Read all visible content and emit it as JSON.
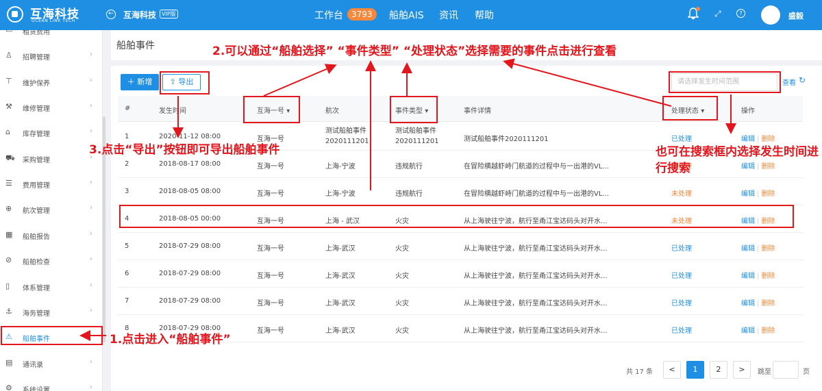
{
  "topbar": {
    "logo_cn": "互海科技",
    "logo_en": "OCEAN LINK TECH",
    "company": "互海科技",
    "vip_tag": "VIP版",
    "menu": [
      {
        "label": "工作台"
      },
      {
        "label": "船舶AIS"
      },
      {
        "label": "资讯"
      },
      {
        "label": "帮助"
      }
    ],
    "workbench_count": "3793",
    "username": "盛毅",
    "accent_color": "#1f8fe4",
    "badge_color": "#f5883a"
  },
  "sidebar": {
    "items": [
      {
        "label": "租赁费用",
        "icon": "lease-icon"
      },
      {
        "label": "招聘管理",
        "icon": "user-icon"
      },
      {
        "label": "维护保养",
        "icon": "tool-icon"
      },
      {
        "label": "维修管理",
        "icon": "wrench-icon"
      },
      {
        "label": "库存管理",
        "icon": "warehouse-icon"
      },
      {
        "label": "采购管理",
        "icon": "cart-icon"
      },
      {
        "label": "费用管理",
        "icon": "coins-icon"
      },
      {
        "label": "航次管理",
        "icon": "globe-icon"
      },
      {
        "label": "船舶报告",
        "icon": "report-icon"
      },
      {
        "label": "船舶检查",
        "icon": "check-icon"
      },
      {
        "label": "体系管理",
        "icon": "book-icon"
      },
      {
        "label": "海务管理",
        "icon": "anchor-icon"
      },
      {
        "label": "船舶事件",
        "icon": "warning-icon",
        "active": true
      },
      {
        "label": "通讯录",
        "icon": "contacts-icon"
      },
      {
        "label": "系统设置",
        "icon": "settings-icon"
      }
    ]
  },
  "main": {
    "page_title": "船舶事件",
    "add_label": "新增",
    "export_label": "导出",
    "search_placeholder": "请选择发生时间范围",
    "query_label": "查看",
    "columns": [
      "#",
      "发生时间",
      "互海一号",
      "航次",
      "事件类型",
      "事件详情",
      "处理状态",
      "操作"
    ],
    "edit_label": "编辑",
    "delete_label": "删除",
    "rows": [
      {
        "no": "1",
        "time": "2020-11-12 08:00",
        "ship": "互海一号",
        "voyage": "测试船舶事件2020111201",
        "type": "测试船舶事件2020111201",
        "detail": "测试船舶事件2020111201",
        "status": "已处理",
        "status_kind": "done"
      },
      {
        "no": "2",
        "time": "2018-08-17 08:00",
        "ship": "互海一号",
        "voyage": "上海-宁波",
        "type": "违规航行",
        "detail": "在冒险横越虾峙门航道的过程中与一出港的VL...",
        "status": "未处理",
        "status_kind": "pending"
      },
      {
        "no": "3",
        "time": "2018-08-05 08:00",
        "ship": "互海一号",
        "voyage": "上海-宁波",
        "type": "违规航行",
        "detail": "在冒险横越虾峙门航道的过程中与一出港的VL...",
        "status": "未处理",
        "status_kind": "pending"
      },
      {
        "no": "4",
        "time": "2018-08-05 00:00",
        "ship": "互海一号",
        "voyage": "上海 - 武汉",
        "type": "火灾",
        "detail": "从上海驶往宁波，航行至甬江宝达码头对开水...",
        "status": "未处理",
        "status_kind": "pending"
      },
      {
        "no": "5",
        "time": "2018-07-29 08:00",
        "ship": "互海一号",
        "voyage": "上海-武汉",
        "type": "火灾",
        "detail": "从上海驶往宁波，航行至甬江宝达码头对开水...",
        "status": "已处理",
        "status_kind": "done"
      },
      {
        "no": "6",
        "time": "2018-07-29 08:00",
        "ship": "互海一号",
        "voyage": "上海-武汉",
        "type": "火灾",
        "detail": "从上海驶往宁波，航行至甬江宝达码头对开水...",
        "status": "已处理",
        "status_kind": "done"
      },
      {
        "no": "7",
        "time": "2018-07-29 08:00",
        "ship": "互海一号",
        "voyage": "上海-武汉",
        "type": "火灾",
        "detail": "从上海驶往宁波，航行至甬江宝达码头对开水...",
        "status": "已处理",
        "status_kind": "done"
      },
      {
        "no": "8",
        "time": "2018-07-29 08:00",
        "ship": "互海一号",
        "voyage": "上海-武汉",
        "type": "火灾",
        "detail": "从上海驶往宁波，航行至甬江宝达码头对开水...",
        "status": "已处理",
        "status_kind": "done"
      }
    ]
  },
  "pagination": {
    "total_text": "共 17 条",
    "prev": "<",
    "pages": [
      "1",
      "2"
    ],
    "current": "1",
    "next": ">",
    "jump_label": "跳至",
    "page_label": "页"
  },
  "annotations": {
    "step1": "1.点击进入“船舶事件”",
    "step2": "2.可以通过“船舶选择” “事件类型” “处理状态”选择需要的事件点击进行查看",
    "step3": "3.点击“导出”按钮即可导出船舶事件",
    "search_tip": "也可在搜索框内选择发生时间进行搜索",
    "color": "#e2161c"
  }
}
